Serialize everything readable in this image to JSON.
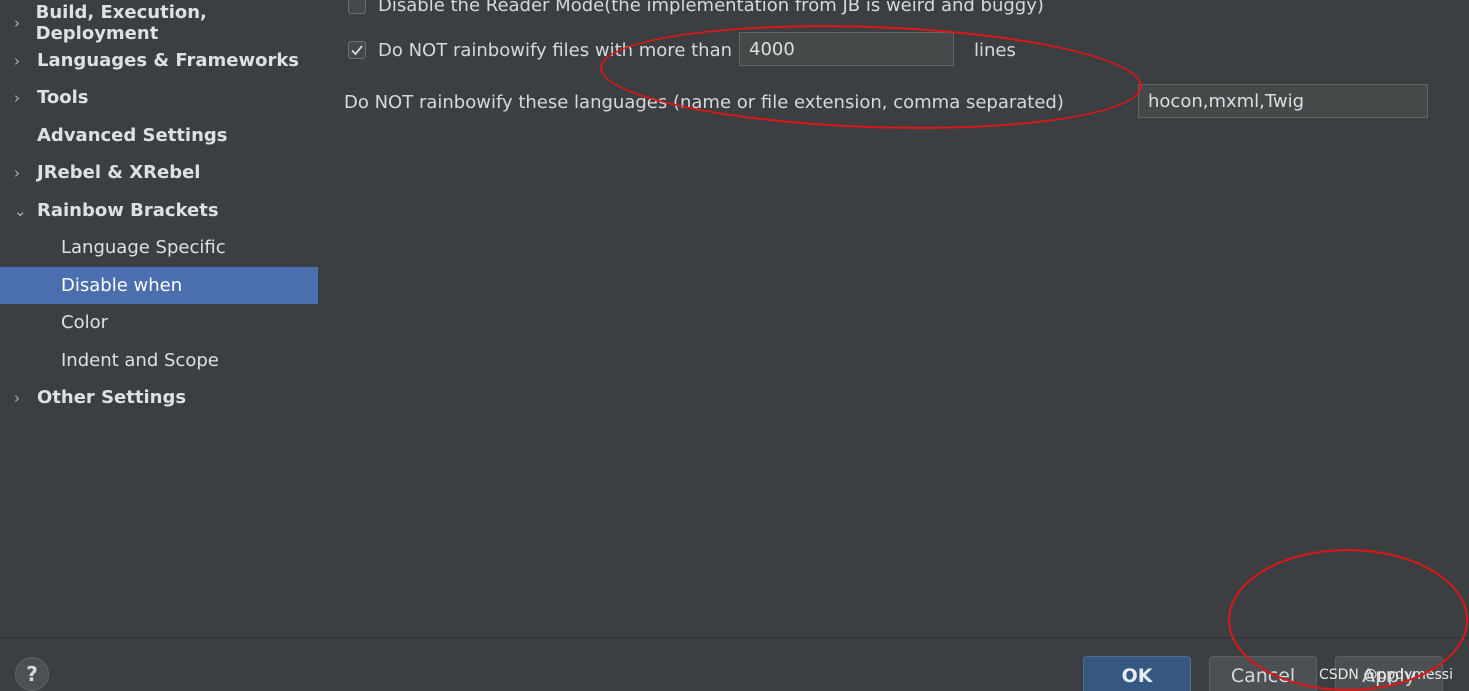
{
  "sidebar": {
    "items": [
      {
        "label": "Build, Execution, Deployment",
        "arrow": "›"
      },
      {
        "label": "Languages & Frameworks",
        "arrow": "›"
      },
      {
        "label": "Tools",
        "arrow": "›"
      },
      {
        "label": "Advanced Settings",
        "arrow": ""
      },
      {
        "label": "JRebel & XRebel",
        "arrow": "›"
      },
      {
        "label": "Rainbow Brackets",
        "arrow": "⌄"
      },
      {
        "label": "Language Specific"
      },
      {
        "label": "Disable when",
        "selected": true
      },
      {
        "label": "Color"
      },
      {
        "label": "Indent and Scope"
      },
      {
        "label": "Other Settings",
        "arrow": "›"
      }
    ]
  },
  "content": {
    "reader_mode_label": "Disable the Reader Mode(the implementation from JB is weird and buggy)",
    "reader_mode_checked": false,
    "max_lines_label": "Do NOT rainbowify files with more than",
    "max_lines_checked": true,
    "max_lines_value": "4000",
    "lines_suffix": "lines",
    "languages_label": "Do NOT rainbowify these languages (name or file extension, comma separated)",
    "languages_value": "hocon,mxml,Twig"
  },
  "footer": {
    "help_label": "?",
    "ok_label": "OK",
    "cancel_label": "Cancel",
    "apply_label": "Apply",
    "watermark": "CSDN @ppdymessi"
  },
  "colors": {
    "background": "#3c3f41",
    "selection": "#4b6eaf",
    "annotation": "#e01515",
    "default_button": "#365880"
  }
}
